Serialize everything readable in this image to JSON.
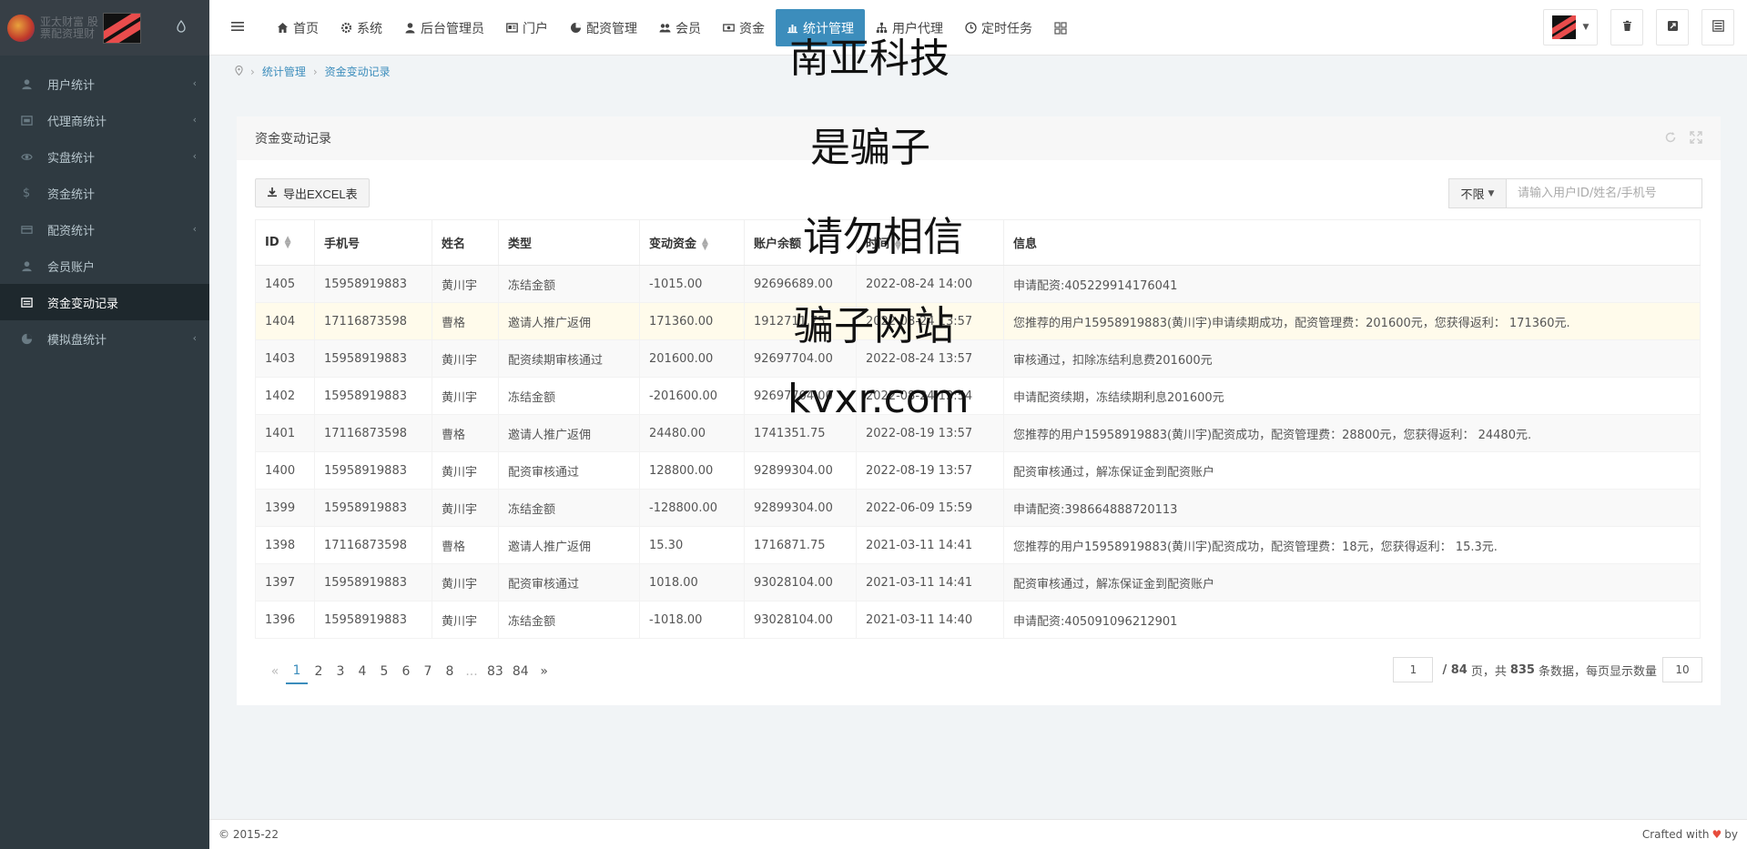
{
  "sidebar": {
    "logo_text": "亚太财富 股票配资理财系统",
    "items": [
      {
        "label": "用户统计",
        "icon": "user-icon",
        "has_children": true,
        "active": false
      },
      {
        "label": "代理商统计",
        "icon": "agent-icon",
        "has_children": true,
        "active": false
      },
      {
        "label": "实盘统计",
        "icon": "eye-icon",
        "has_children": true,
        "active": false
      },
      {
        "label": "资金统计",
        "icon": "dollar-icon",
        "has_children": false,
        "active": false
      },
      {
        "label": "配资统计",
        "icon": "card-icon",
        "has_children": true,
        "active": false
      },
      {
        "label": "会员账户",
        "icon": "user-icon",
        "has_children": false,
        "active": false
      },
      {
        "label": "资金变动记录",
        "icon": "list-icon",
        "has_children": false,
        "active": true
      },
      {
        "label": "模拟盘统计",
        "icon": "pie-icon",
        "has_children": true,
        "active": false
      }
    ]
  },
  "topnav": {
    "items": [
      {
        "label": "首页",
        "icon": "home-icon"
      },
      {
        "label": "系统",
        "icon": "gear-icon"
      },
      {
        "label": "后台管理员",
        "icon": "user-icon"
      },
      {
        "label": "门户",
        "icon": "portal-icon"
      },
      {
        "label": "配资管理",
        "icon": "pie-icon"
      },
      {
        "label": "会员",
        "icon": "users-icon"
      },
      {
        "label": "资金",
        "icon": "money-icon"
      },
      {
        "label": "统计管理",
        "icon": "chart-icon",
        "active": true
      },
      {
        "label": "用户代理",
        "icon": "sitemap-icon"
      },
      {
        "label": "定时任务",
        "icon": "clock-icon"
      }
    ]
  },
  "breadcrumb": {
    "items": [
      "统计管理",
      "资金变动记录"
    ]
  },
  "panel": {
    "title": "资金变动记录",
    "export_label": "导出EXCEL表",
    "filter_label": "不限",
    "search_placeholder": "请输入用户ID/姓名/手机号"
  },
  "table": {
    "headers": [
      "ID",
      "手机号",
      "姓名",
      "类型",
      "变动资金",
      "账户余额",
      "时间",
      "信息"
    ],
    "rows": [
      [
        "1405",
        "15958919883",
        "黄川宇",
        "冻结金额",
        "-1015.00",
        "92696689.00",
        "2022-08-24 14:00",
        "申请配资:405229914176041"
      ],
      [
        "1404",
        "17116873598",
        "曹格",
        "邀请人推广返佣",
        "171360.00",
        "1912711.75",
        "2022-08-24 13:57",
        "您推荐的用户15958919883(黄川宇)申请续期成功，配资管理费：201600元，您获得返利： 171360元."
      ],
      [
        "1403",
        "15958919883",
        "黄川宇",
        "配资续期审核通过",
        "201600.00",
        "92697704.00",
        "2022-08-24 13:57",
        "审核通过，扣除冻结利息费201600元"
      ],
      [
        "1402",
        "15958919883",
        "黄川宇",
        "冻结金额",
        "-201600.00",
        "92697704.00",
        "2022-08-24 13:54",
        "申请配资续期，冻结续期利息201600元"
      ],
      [
        "1401",
        "17116873598",
        "曹格",
        "邀请人推广返佣",
        "24480.00",
        "1741351.75",
        "2022-08-19 13:57",
        "您推荐的用户15958919883(黄川宇)配资成功，配资管理费：28800元，您获得返利： 24480元."
      ],
      [
        "1400",
        "15958919883",
        "黄川宇",
        "配资审核通过",
        "128800.00",
        "92899304.00",
        "2022-08-19 13:57",
        "配资审核通过，解冻保证金到配资账户"
      ],
      [
        "1399",
        "15958919883",
        "黄川宇",
        "冻结金额",
        "-128800.00",
        "92899304.00",
        "2022-06-09 15:59",
        "申请配资:398664888720113"
      ],
      [
        "1398",
        "17116873598",
        "曹格",
        "邀请人推广返佣",
        "15.30",
        "1716871.75",
        "2021-03-11 14:41",
        "您推荐的用户15958919883(黄川宇)配资成功，配资管理费：18元，您获得返利： 15.3元."
      ],
      [
        "1397",
        "15958919883",
        "黄川宇",
        "配资审核通过",
        "1018.00",
        "93028104.00",
        "2021-03-11 14:41",
        "配资审核通过，解冻保证金到配资账户"
      ],
      [
        "1396",
        "15958919883",
        "黄川宇",
        "冻结金额",
        "-1018.00",
        "93028104.00",
        "2021-03-11 14:40",
        "申请配资:405091096212901"
      ]
    ]
  },
  "pagination": {
    "prev": "«",
    "pages": [
      "1",
      "2",
      "3",
      "4",
      "5",
      "6",
      "7",
      "8",
      "...",
      "83",
      "84"
    ],
    "next": "»",
    "current_page": "1",
    "total_pages_text": "/ 84",
    "pages_word": "页，共",
    "total_count": "835",
    "count_word": "条数据，每页显示数量",
    "page_size": "10"
  },
  "footer": {
    "copyright": "© 2015-22",
    "crafted": "Crafted with",
    "by": "by"
  },
  "watermark": {
    "lines": [
      "南亚科技",
      "是骗子",
      "请勿相信",
      "骗子网站",
      "kvxr.com"
    ]
  }
}
